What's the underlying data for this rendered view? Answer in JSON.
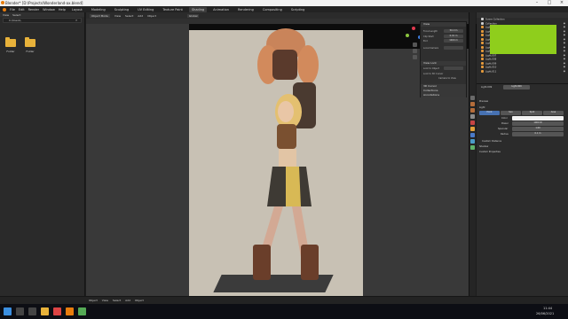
{
  "window": {
    "title": "Blender* [D:\\Projects\\Wonderland-ax.blend]"
  },
  "menu": [
    "File",
    "Edit",
    "Render",
    "Window",
    "Help"
  ],
  "workspace_tabs": [
    "Layout",
    "Modeling",
    "Sculpting",
    "UV Editing",
    "Texture Paint",
    "Shading",
    "Animation",
    "Rendering",
    "Compositing",
    "Scripting"
  ],
  "active_workspace": "Shading",
  "file_browser": {
    "nav": [
      "View",
      "Select"
    ],
    "path": "C:\\Users\\",
    "folders": [
      "Folder",
      "Folder"
    ]
  },
  "viewport": {
    "header": [
      "Object Mode",
      "View",
      "Select",
      "Add",
      "Object"
    ],
    "shading_label": "Global",
    "footer": [
      "Object",
      "View",
      "Select",
      "Add",
      "Object"
    ]
  },
  "npanel": {
    "title": "View",
    "focal_label": "Focal Length",
    "focal_value": "50 mm",
    "clip_label": "Clip Start",
    "clip_start": "0.01 m",
    "clip_end": "1000 m",
    "end_label": "End",
    "local_camera": "Local Camera",
    "view_lock": "View Lock",
    "lock_to_object": "Lock to Object",
    "lock_to_3d_cursor": "Lock to 3D Cursor",
    "camera_to_view": "Camera to View",
    "sections": [
      "3D Cursor",
      "Collections",
      "Annotations"
    ]
  },
  "outliner": {
    "rows": [
      "Scene Collection",
      "Collection",
      "Light",
      "Light.001",
      "Light.002",
      "Light.003",
      "Light.004",
      "Light.005",
      "Light.006",
      "Light.007",
      "Light.008",
      "Light.009",
      "Light.010",
      "Light.011"
    ]
  },
  "properties": {
    "object": "Light.009",
    "breadcrumb": "Light.009",
    "sections": [
      "Preview",
      "Light"
    ],
    "light_types": [
      "Point",
      "Sun",
      "Spot",
      "Area"
    ],
    "active_type": "Point",
    "fields": [
      {
        "label": "Color",
        "value": ""
      },
      {
        "label": "Power",
        "value": "1000 W"
      },
      {
        "label": "Specular",
        "value": "1.00"
      },
      {
        "label": "Radius",
        "value": "0.1 m"
      }
    ],
    "subsections": [
      "Custom Distance",
      "Shadow",
      "Custom Properties"
    ]
  },
  "colors": {
    "accent": "#4772b3",
    "green_selection": "#8fce1c",
    "folder": "#e8b23a",
    "camera_bg": "#c8c1b4"
  },
  "taskbar": {
    "time": "11:44",
    "date": "26/06/2021"
  },
  "icons": [
    "search-icon",
    "folder-icon",
    "camera-icon",
    "light-icon",
    "eye-icon",
    "windows-start-icon",
    "blender-icon"
  ]
}
